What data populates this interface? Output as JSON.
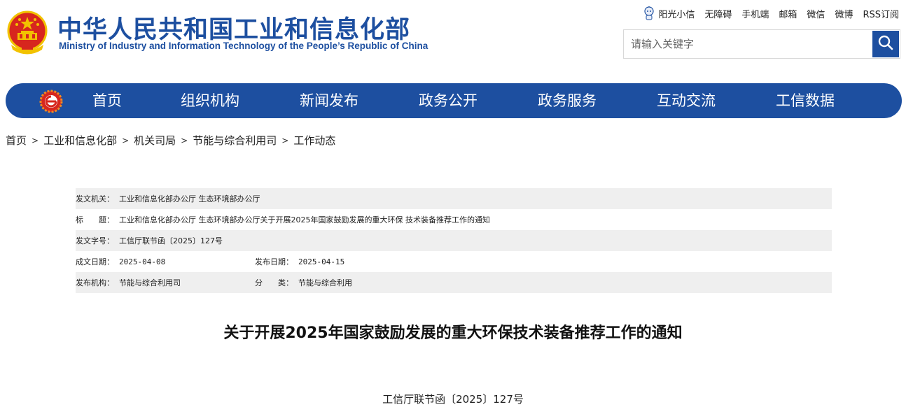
{
  "header": {
    "title_cn": "中华人民共和国工业和信息化部",
    "title_en": "Ministry of Industry and Information Technology of the People’s Republic of China",
    "emblem_icon": "national-emblem-icon"
  },
  "toplinks": [
    "阳光小信",
    "无障碍",
    "手机端",
    "邮箱",
    "微信",
    "微博",
    "RSS订阅"
  ],
  "search": {
    "placeholder": "请输入关键字",
    "button_icon": "search-icon"
  },
  "nav": {
    "logo_icon": "miit-logo-icon",
    "items": [
      "首页",
      "组织机构",
      "新闻发布",
      "政务公开",
      "政务服务",
      "互动交流",
      "工信数据"
    ]
  },
  "breadcrumb": [
    "首页",
    "工业和信息化部",
    "机关司局",
    "节能与综合利用司",
    "工作动态"
  ],
  "meta": {
    "issuer_label": "发文机关：",
    "issuer": "工业和信息化部办公厅 生态环境部办公厅",
    "title_label": "标　　题：",
    "title": "工业和信息化部办公厅 生态环境部办公厅关于开展2025年国家鼓励发展的重大环保 技术装备推荐工作的通知",
    "docno_label": "发文字号：",
    "docno": "工信厅联节函〔2025〕127号",
    "date_label": "成文日期：",
    "date": "2025-04-08",
    "pubdate_label": "发布日期：",
    "pubdate": "2025-04-15",
    "org_label": "发布机构：",
    "org": "节能与综合利用司",
    "category_label": "分　　类：",
    "category": "节能与综合利用"
  },
  "article": {
    "title": "关于开展2025年国家鼓励发展的重大环保技术装备推荐工作的通知",
    "doc_no": "工信厅联节函〔2025〕127号"
  },
  "colors": {
    "brand_blue": "#1d4fa0",
    "emblem_red": "#d7261e",
    "emblem_gold": "#f2c200",
    "meta_shade": "#efefef"
  }
}
